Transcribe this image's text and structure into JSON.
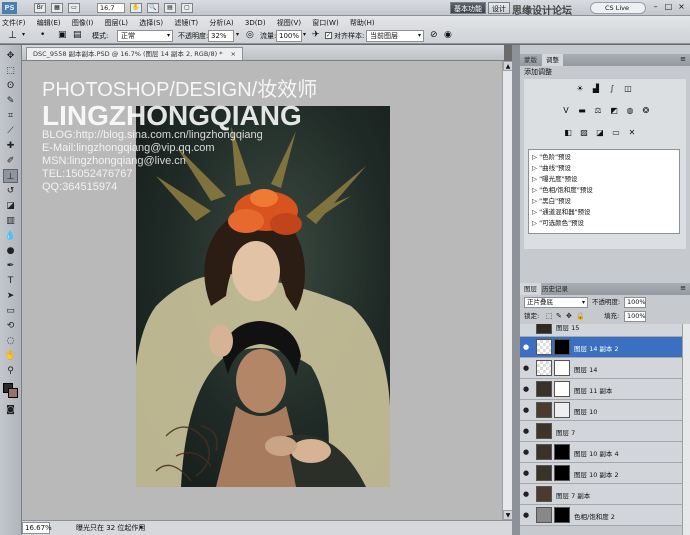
{
  "app": {
    "logo": "PS",
    "zoom_value": "16.7",
    "workspace_active": "基本功能",
    "workspace_other": "设计",
    "watermark_site": "思缘设计论坛",
    "cs_live": "CS Live"
  },
  "menu": [
    "文件(F)",
    "编辑(E)",
    "图像(I)",
    "图层(L)",
    "选择(S)",
    "滤镜(T)",
    "分析(A)",
    "3D(D)",
    "视图(V)",
    "窗口(W)",
    "帮助(H)"
  ],
  "options": {
    "mode_label": "模式:",
    "mode_value": "正常",
    "opacity_label": "不透明度:",
    "opacity_value": "32%",
    "flow_label": "流量:",
    "flow_value": "100%",
    "align_label": "对齐",
    "sample_label": "样本:",
    "sample_value": "当前图层"
  },
  "document": {
    "tab_title": "DSC_9558 副本副本.PSD @ 16.7% (图层 14 副本 2, RGB/8) *"
  },
  "watermark": {
    "line1": "PHOTOSHOP/DESIGN/妆效师",
    "line2": "LINGZHONGQIANG",
    "blog": "BLOG:http://blog.sina.com.cn/lingzhongqiang",
    "email": "E-Mail:lingzhongqiang@vip.qq.com",
    "msn": "MSN:lingzhongqiang@live.cn",
    "tel": "TEL:15052476767",
    "qq": "QQ:364515974"
  },
  "status": {
    "zoom": "16.67%",
    "info": "曝光只在 32 位起作用"
  },
  "adjust_panel": {
    "tabs": [
      "调整"
    ],
    "title": "添加调整",
    "presets": [
      "\"色阶\"预设",
      "\"曲线\"预设",
      "\"曝光度\"预设",
      "\"色相/饱和度\"预设",
      "\"黑白\"预设",
      "\"通道混和器\"预设",
      "\"可选颜色\"预设"
    ]
  },
  "layers_panel": {
    "tabs": [
      "图层",
      "历史记录"
    ],
    "blend_mode": "正片叠底",
    "opacity_label": "不透明度:",
    "opacity_value": "100%",
    "lock_label": "锁定:",
    "fill_label": "填充:",
    "fill_value": "100%",
    "layers": [
      "图层 15",
      "图层 14 副本 2",
      "图层 14",
      "图层 11 副本",
      "图层 10",
      "图层 7",
      "图层 10 副本 4",
      "图层 10 副本 2",
      "图层 7 副本",
      "色相/饱和度 2"
    ],
    "selected_index": 1
  }
}
